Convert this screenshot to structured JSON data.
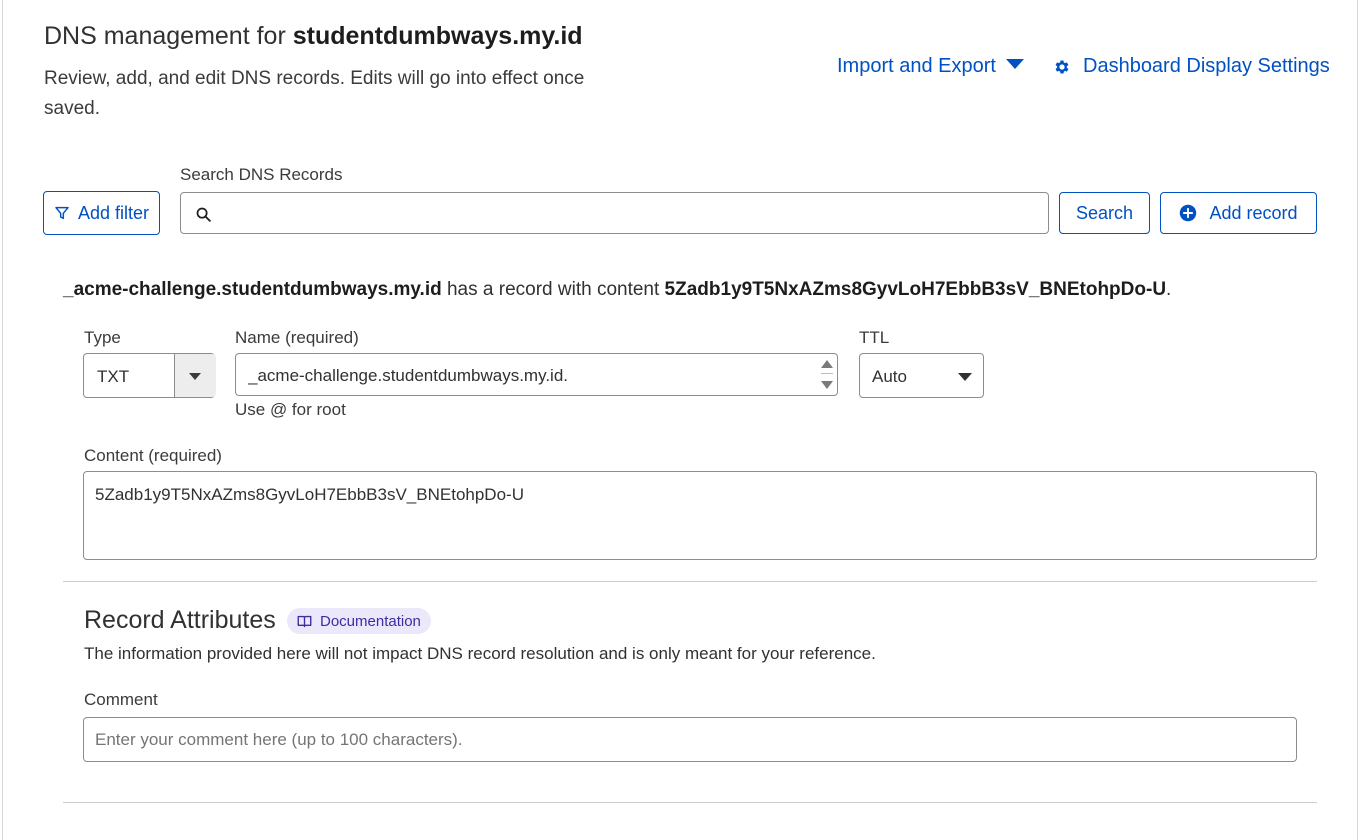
{
  "header": {
    "title_prefix": "DNS management for ",
    "domain": "studentdumbways.my.id",
    "subtitle": "Review, add, and edit DNS records. Edits will go into effect once saved.",
    "import_export_label": "Import and Export",
    "display_settings_label": "Dashboard Display Settings"
  },
  "search": {
    "label": "Search DNS Records",
    "value": "",
    "add_filter_label": "Add filter",
    "search_button_label": "Search",
    "add_record_label": "Add record"
  },
  "record": {
    "sentence_name": "_acme-challenge.studentdumbways.my.id",
    "sentence_middle": " has a record with content ",
    "sentence_content": "5Zadb1y9T5NxAZms8GyvLoH7EbbB3sV_BNEtohpDo-U",
    "sentence_end": ".",
    "type_label": "Type",
    "type_value": "TXT",
    "name_label": "Name (required)",
    "name_value": "_acme-challenge.studentdumbways.my.id.",
    "name_hint": "Use @ for root",
    "ttl_label": "TTL",
    "ttl_value": "Auto",
    "content_label": "Content (required)",
    "content_value": "5Zadb1y9T5NxAZms8GyvLoH7EbbB3sV_BNEtohpDo-U"
  },
  "attributes": {
    "title": "Record Attributes",
    "documentation_label": "Documentation",
    "description": "The information provided here will not impact DNS record resolution and is only meant for your reference.",
    "comment_label": "Comment",
    "comment_placeholder": "Enter your comment here (up to 100 characters).",
    "comment_value": ""
  },
  "colors": {
    "accent": "#0051c3",
    "badge_bg": "#ece8fb",
    "text": "#313131"
  },
  "icons": [
    "filter-icon",
    "search-icon",
    "plus-circle-icon",
    "gear-icon",
    "chevron-down-icon",
    "book-icon"
  ]
}
